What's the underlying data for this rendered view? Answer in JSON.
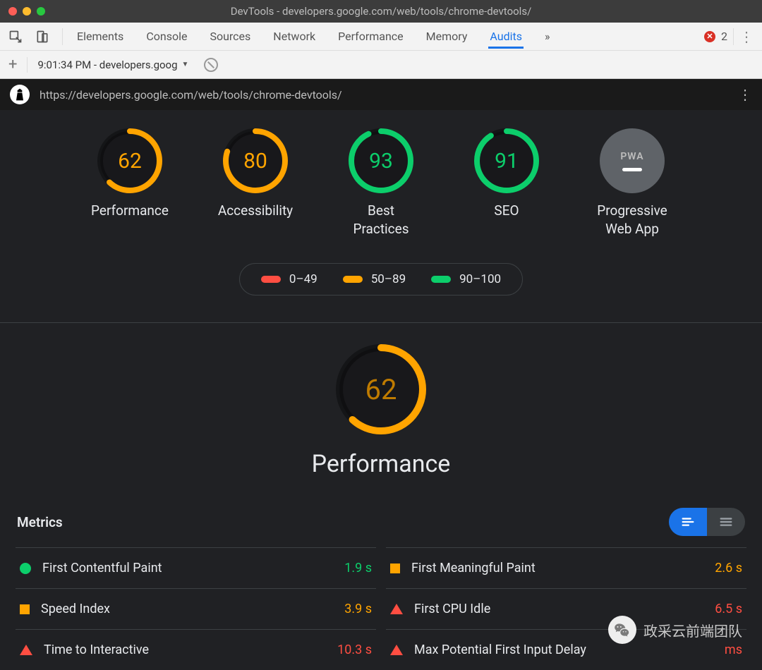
{
  "window": {
    "title": "DevTools - developers.google.com/web/tools/chrome-devtools/"
  },
  "toolbar": {
    "tabs": [
      "Elements",
      "Console",
      "Sources",
      "Network",
      "Performance",
      "Memory",
      "Audits"
    ],
    "active_tab": "Audits",
    "overflow": "»",
    "error_count": "2",
    "kebab": "⋮"
  },
  "audit_bar": {
    "run_label": "9:01:34 PM - developers.goog",
    "dropdown_glyph": "▼"
  },
  "url_bar": {
    "logo_glyph": "A",
    "url": "https://developers.google.com/web/tools/chrome-devtools/",
    "kebab": "⋮"
  },
  "gauges": [
    {
      "key": "performance",
      "score": 62,
      "label": "Performance",
      "color": "#ffa400"
    },
    {
      "key": "accessibility",
      "score": 80,
      "label": "Accessibility",
      "color": "#ffa400"
    },
    {
      "key": "best",
      "score": 93,
      "label": "Best\nPractices",
      "color": "#0cce6b"
    },
    {
      "key": "seo",
      "score": 91,
      "label": "SEO",
      "color": "#0cce6b"
    }
  ],
  "pwa": {
    "label": "Progressive\nWeb App",
    "badge": "PWA"
  },
  "legend": [
    {
      "range": "0–49",
      "color": "red"
    },
    {
      "range": "50–89",
      "color": "orange"
    },
    {
      "range": "90–100",
      "color": "green"
    }
  ],
  "section": {
    "score": 62,
    "title": "Performance",
    "color": "#ffa400"
  },
  "metrics_title": "Metrics",
  "metrics": [
    {
      "shape": "circle",
      "name": "First Contentful Paint",
      "value": "1.9 s",
      "cls": "v-green"
    },
    {
      "shape": "square",
      "name": "First Meaningful Paint",
      "value": "2.6 s",
      "cls": "v-orange"
    },
    {
      "shape": "square",
      "name": "Speed Index",
      "value": "3.9 s",
      "cls": "v-orange"
    },
    {
      "shape": "triangle",
      "name": "First CPU Idle",
      "value": "6.5 s",
      "cls": "v-red"
    },
    {
      "shape": "triangle",
      "name": "Time to Interactive",
      "value": "10.3 s",
      "cls": "v-red"
    },
    {
      "shape": "triangle",
      "name": "Max Potential First Input Delay",
      "value": "ms",
      "cls": "v-red"
    }
  ],
  "watermark": {
    "text": "政采云前端团队"
  }
}
